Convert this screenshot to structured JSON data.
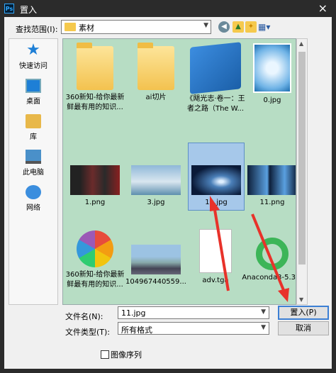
{
  "window": {
    "title": "置入",
    "app_icon": "Ps"
  },
  "toolbar": {
    "look_in_label": "查找范围(I):",
    "current_folder": "素材"
  },
  "places": [
    {
      "label": "快速访问",
      "icon": "star-icon"
    },
    {
      "label": "桌面",
      "icon": "desktop-icon"
    },
    {
      "label": "库",
      "icon": "library-icon"
    },
    {
      "label": "此电脑",
      "icon": "computer-icon"
    },
    {
      "label": "网络",
      "icon": "network-icon"
    }
  ],
  "files": [
    {
      "name": "360新知-给你最新鲜最有用的知识...",
      "line1": "360新知-给你最新",
      "line2": "鲜最有用的知识...",
      "kind": "folder"
    },
    {
      "name": "ai切片",
      "line1": "ai切片",
      "line2": "",
      "kind": "folder"
    },
    {
      "name": "《飓光志·卷一：王者之路（The W...",
      "line1": "《飓光志·卷一：王",
      "line2": "者之路（The W...",
      "kind": "book"
    },
    {
      "name": "0.jpg",
      "line1": "0.jpg",
      "line2": "",
      "kind": "image"
    },
    {
      "name": "1.png",
      "line1": "1.png",
      "line2": "",
      "kind": "image"
    },
    {
      "name": "3.jpg",
      "line1": "3.jpg",
      "line2": "",
      "kind": "image"
    },
    {
      "name": "11.jpg",
      "line1": "11.jpg",
      "line2": "",
      "kind": "image",
      "selected": true
    },
    {
      "name": "11.png",
      "line1": "11.png",
      "line2": "",
      "kind": "image"
    },
    {
      "name": "360新知-给你最新鲜最有用的知识...",
      "line1": "360新知-给你最新",
      "line2": "鲜最有用的知识...",
      "kind": "image"
    },
    {
      "name": "104967440559...",
      "line1": "104967440559...",
      "line2": "",
      "kind": "image"
    },
    {
      "name": "adv.tga",
      "line1": "adv.tga",
      "line2": "",
      "kind": "document"
    },
    {
      "name": "Anaconda3-5.3...",
      "line1": "Anaconda3-5.3...",
      "line2": "",
      "kind": "app"
    }
  ],
  "form": {
    "filename_label": "文件名(N):",
    "filename_value": "11.jpg",
    "filetype_label": "文件类型(T):",
    "filetype_value": "所有格式",
    "place_button": "置入(P)",
    "cancel_button": "取消",
    "image_sequence_label": "图像序列"
  }
}
